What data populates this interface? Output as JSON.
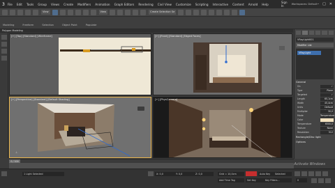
{
  "app": {
    "logo": "3",
    "sign_in": "Sign In",
    "workspaces": "Workspaces: Default",
    "win_controls": [
      "–",
      "□",
      "✕"
    ]
  },
  "menu": [
    "File",
    "Edit",
    "Tools",
    "Group",
    "Views",
    "Create",
    "Modifiers",
    "Animation",
    "Graph Editors",
    "Rendering",
    "Civil View",
    "Customize",
    "Scripting",
    "Interactive",
    "Content",
    "Arnold",
    "Help"
  ],
  "ribbon": {
    "mode": "Polygon Modeling",
    "tabs": [
      "Modeling",
      "Freeform",
      "Selection",
      "Object Paint",
      "Populate"
    ]
  },
  "toolbar": {
    "view_dropdown": "View",
    "selection_set": "Create Selection Se"
  },
  "viewports": {
    "top_label": "[+] [Top] [Standard] [Wireframe]",
    "front_label": "[+] [Front] [Standard] [Edged Faces]",
    "persp_label": "[+] [Perspective] [Standard] [Default Shading]",
    "render_label": "[+] [PhysCamera]"
  },
  "cmd_panel": {
    "object_name": "VRayLight001",
    "modifier_list": "Modifier List",
    "stack_item": "VRayLight",
    "sections": [
      "General",
      "Rectangle/Disc light",
      "Options"
    ],
    "params": [
      {
        "k": "On",
        "v": "✓"
      },
      {
        "k": "Type",
        "v": "Plane"
      },
      {
        "k": "Targeted",
        "v": "✓"
      },
      {
        "k": "Length",
        "v": "65,1cm"
      },
      {
        "k": "Width",
        "v": "45,4cm"
      },
      {
        "k": "Units",
        "v": "Default (image)"
      },
      {
        "k": "Multiplier",
        "v": "30,0"
      },
      {
        "k": "Mode",
        "v": "Temperature"
      },
      {
        "k": "Color",
        "v": ""
      },
      {
        "k": "Temperature",
        "v": "6500,0"
      },
      {
        "k": "Texture",
        "v": "None"
      },
      {
        "k": "Resolution",
        "v": "512"
      }
    ]
  },
  "timeline": {
    "frame": "0 / 100"
  },
  "status": {
    "selected": "1 Light Selected",
    "x": "X: 0,0",
    "y": "Y: 0,0",
    "z": "Z: 0,0",
    "grid": "Grid = 10,0cm",
    "autokey": "Auto Key",
    "selected_dd": "Selected",
    "setkey": "Set Key",
    "key_filters": "Key Filters...",
    "add_time_tag": "Add Time Tag",
    "frame_field": "0"
  },
  "watermark": "Activate Windows",
  "colors": {
    "accent": "#3e6fae",
    "active_border": "#e9b44c",
    "record_red": "#c62e2e"
  },
  "icons": [
    "app-logo-icon",
    "undo-icon",
    "redo-icon",
    "link-icon",
    "select-icon",
    "move-icon",
    "rotate-icon",
    "scale-icon",
    "snap-icon",
    "render-icon",
    "play-icon",
    "key-icon"
  ]
}
